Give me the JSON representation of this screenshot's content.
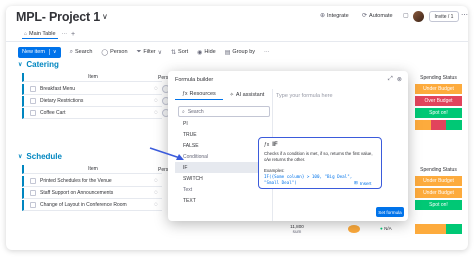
{
  "app": {
    "title": "MPL- Project 1",
    "title_chevron": "∨",
    "integrate_label": "Integrate",
    "automate_label": "Automate",
    "invite_label": "Invite / 1",
    "tab_main": "Main Table",
    "tab_more": "···",
    "tab_add": "+"
  },
  "toolbar": {
    "new_item": "New item",
    "new_item_caret": "∨",
    "search": "Search",
    "person": "Person",
    "filter": "Filter",
    "filter_caret": "∨",
    "sort": "Sort",
    "hide": "Hide",
    "group_by": "Group by",
    "more": "···"
  },
  "groups": [
    {
      "name": "Catering",
      "color": "#0086c0",
      "header": {
        "item": "Item",
        "person": "Person"
      },
      "rows": [
        {
          "item": "Breakfast Menu",
          "status": "Under Budget",
          "status_color": "#fdab3d"
        },
        {
          "item": "Dietary Restrictions",
          "status": "Over Budget",
          "status_color": "#e2445c"
        },
        {
          "item": "Coffee Cart",
          "status": "Spot on!",
          "status_color": "#00c875"
        }
      ]
    },
    {
      "name": "Schedule",
      "color": "#0086c0",
      "header": {
        "item": "Item",
        "person": "Person"
      },
      "rows": [
        {
          "item": "Printed Schedules for the Venue",
          "status": "Under Budget",
          "status_color": "#fdab3d"
        },
        {
          "item": "Staff Support on Announcements",
          "status": "Under Budget",
          "status_color": "#fdab3d"
        },
        {
          "item": "Change of Layout in Conference Room",
          "status": "Spot on!",
          "status_color": "#00c875"
        }
      ]
    }
  ],
  "status_header": "Spending Status",
  "summary": {
    "value": "11,800",
    "unit": "sum",
    "status_na": "N/A"
  },
  "formula_builder": {
    "title": "Formula builder",
    "tab_resources": "Resources",
    "tab_ai": "AI assistant",
    "search_placeholder": "Search",
    "editor_placeholder": "Type your formula here",
    "items": [
      {
        "label": "PI",
        "kind": "item"
      },
      {
        "label": "TRUE",
        "kind": "item"
      },
      {
        "label": "FALSE",
        "kind": "item"
      },
      {
        "label": "Conditional",
        "kind": "category"
      },
      {
        "label": "IF",
        "kind": "selected"
      },
      {
        "label": "SWITCH",
        "kind": "item"
      },
      {
        "label": "Text",
        "kind": "category"
      },
      {
        "label": "TEXT",
        "kind": "item"
      }
    ],
    "tooltip": {
      "name": "IF",
      "description": "Checks if a condition is met, if so, returns the first value, o/w returns the other.",
      "examples_label": "Examples:",
      "code": "IF({Some column} > 100, \"Big Deal\", \"Small Deal\")",
      "insert_label": "Insert"
    },
    "set_formula": "Set formula"
  },
  "colors": {
    "accent": "#0073ea",
    "callout_border": "#3b5bdb",
    "under_budget": "#fdab3d",
    "over_budget": "#e2445c",
    "spot_on": "#00c875"
  }
}
